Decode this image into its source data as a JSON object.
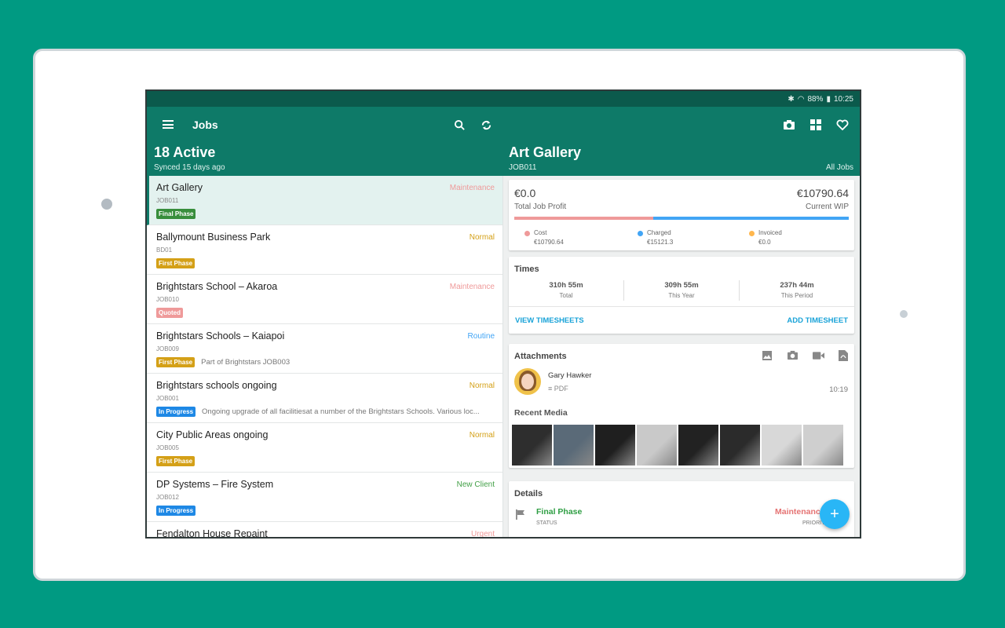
{
  "status_bar": {
    "battery": "88%",
    "time": "10:25"
  },
  "left_header": {
    "title": "Jobs",
    "count_title": "18 Active",
    "synced": "Synced 15 days ago"
  },
  "right_header": {
    "title": "Art Gallery",
    "code": "JOB011",
    "all_jobs": "All Jobs"
  },
  "jobs": [
    {
      "name": "Art Gallery",
      "code": "JOB011",
      "type": "Maintenance",
      "type_color": "#ef9a9a",
      "tag": "Final Phase",
      "tag_color": "#388e3c",
      "note": ""
    },
    {
      "name": "Ballymount Business Park",
      "code": "BD01",
      "type": "Normal",
      "type_color": "#d4a017",
      "tag": "First Phase",
      "tag_color": "#d4a017",
      "note": ""
    },
    {
      "name": "Brightstars School – Akaroa",
      "code": "JOB010",
      "type": "Maintenance",
      "type_color": "#ef9a9a",
      "tag": "Quoted",
      "tag_color": "#ef9a9a",
      "note": ""
    },
    {
      "name": "Brightstars Schools – Kaiapoi",
      "code": "JOB009",
      "type": "Routine",
      "type_color": "#42a5f5",
      "tag": "First Phase",
      "tag_color": "#d4a017",
      "note": "Part of Brightstars JOB003"
    },
    {
      "name": "Brightstars schools ongoing",
      "code": "JOB001",
      "type": "Normal",
      "type_color": "#d4a017",
      "tag": "In Progress",
      "tag_color": "#1e88e5",
      "note": "Ongoing upgrade of all facilitiesat a number of the Brightstars Schools. Various loc..."
    },
    {
      "name": "City Public Areas ongoing",
      "code": "JOB005",
      "type": "Normal",
      "type_color": "#d4a017",
      "tag": "First Phase",
      "tag_color": "#d4a017",
      "note": ""
    },
    {
      "name": "DP Systems – Fire System",
      "code": "JOB012",
      "type": "New Client",
      "type_color": "#43a047",
      "tag": "In Progress",
      "tag_color": "#1e88e5",
      "note": ""
    },
    {
      "name": "Fendalton House Repaint",
      "code": "",
      "type": "Urgent",
      "type_color": "#ef9a9a",
      "tag": "",
      "tag_color": "#ffffff",
      "note": ""
    }
  ],
  "profit": {
    "profit_value": "€0.0",
    "profit_label": "Total Job Profit",
    "wip_value": "€10790.64",
    "wip_label": "Current WIP",
    "cost_fraction": 0.415,
    "legend": [
      {
        "label": "Cost",
        "value": "€10790.64",
        "color": "#ef9a9a"
      },
      {
        "label": "Charged",
        "value": "€15121.3",
        "color": "#42a5f5"
      },
      {
        "label": "Invoiced",
        "value": "€0.0",
        "color": "#ffb74d"
      }
    ]
  },
  "times": {
    "title": "Times",
    "columns": [
      {
        "value": "310h 55m",
        "label": "Total"
      },
      {
        "value": "309h 55m",
        "label": "This Year"
      },
      {
        "value": "237h 44m",
        "label": "This Period"
      }
    ],
    "view_link": "VIEW TIMESHEETS",
    "add_link": "ADD TIMESHEET"
  },
  "attachments": {
    "title": "Attachments",
    "item": {
      "name": "Gary Hawker",
      "type": "PDF",
      "time": "10:19"
    },
    "media_title": "Recent Media",
    "thumbs": [
      "#2e2e2e",
      "#5a6a78",
      "#1f1f1f",
      "#c9c9c9",
      "#222222",
      "#2b2b2b",
      "#d8d8d8",
      "#cfcfcf"
    ]
  },
  "details": {
    "title": "Details",
    "status_value": "Final Phase",
    "status_label": "STATUS",
    "priority_value": "Maintenance",
    "priority_label": "PRIORITY"
  },
  "fab": {
    "label": "+"
  }
}
